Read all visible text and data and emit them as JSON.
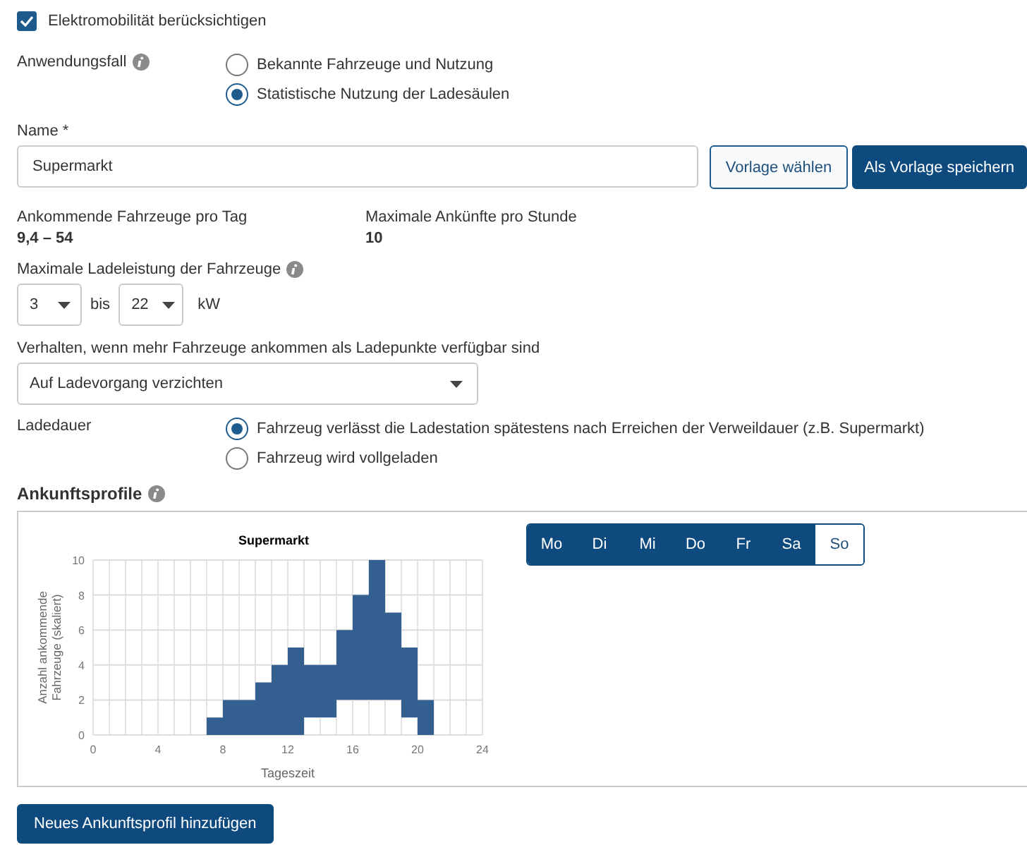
{
  "checkbox": {
    "label": "Elektromobilität berücksichtigen",
    "checked": true
  },
  "use_case": {
    "label": "Anwendungsfall",
    "options": [
      {
        "label": "Bekannte Fahrzeuge und Nutzung",
        "selected": false
      },
      {
        "label": "Statistische Nutzung der Ladesäulen",
        "selected": true
      }
    ]
  },
  "name_field": {
    "label": "Name *",
    "value": "Supermarkt"
  },
  "buttons": [
    {
      "label": "Vorlage wählen",
      "kind": "secondary"
    },
    {
      "label": "Als Vorlage speichern",
      "kind": "primary"
    }
  ],
  "stats": [
    {
      "label": "Ankommende Fahrzeuge pro Tag",
      "value": "9,4 – 54"
    },
    {
      "label": "Maximale Ankünfte pro Stunde",
      "value": "10"
    }
  ],
  "power": {
    "label": "Maximale Ladeleistung der Fahrzeuge",
    "from": "3",
    "separator": "bis",
    "to": "22",
    "unit": "kW"
  },
  "behavior": {
    "label": "Verhalten, wenn mehr Fahrzeuge ankommen als Ladepunkte verfügbar sind",
    "value": "Auf Ladevorgang verzichten"
  },
  "duration": {
    "label": "Ladedauer",
    "options": [
      {
        "label": "Fahrzeug verlässt die Ladestation spätestens nach Erreichen der Verweildauer (z.B. Supermarkt)",
        "selected": true
      },
      {
        "label": "Fahrzeug wird vollgeladen",
        "selected": false
      }
    ]
  },
  "profiles": {
    "title": "Ankunftsprofile",
    "chart_data": {
      "type": "area",
      "title": "Supermarkt",
      "xlabel": "Tageszeit",
      "ylabel": "Anzahl ankommende Fahrzeuge (skaliert)",
      "x": [
        7,
        8,
        8,
        9,
        9,
        10,
        10,
        11,
        11,
        12,
        12,
        13,
        13,
        14,
        14,
        15,
        15,
        16,
        16,
        17,
        17,
        18,
        18,
        19,
        19,
        20,
        20,
        21
      ],
      "series": [
        {
          "color": "#335f91",
          "values": [
            1,
            1,
            2,
            2,
            2,
            2,
            3,
            3,
            4,
            4,
            5,
            5,
            4,
            4,
            4,
            4,
            6,
            6,
            8,
            8,
            10,
            10,
            7,
            7,
            5,
            5,
            2,
            2
          ]
        },
        {
          "color": "#ffffff",
          "values": [
            0,
            0,
            0,
            0,
            0,
            0,
            0,
            0,
            0,
            0,
            0,
            0,
            1,
            1,
            1,
            1,
            2,
            2,
            2,
            2,
            2,
            2,
            2,
            2,
            1,
            1,
            0,
            0
          ]
        }
      ],
      "grid": true,
      "xlim": [
        0,
        24
      ],
      "ylim": [
        0,
        10
      ],
      "xticks": [
        0,
        4,
        8,
        12,
        16,
        20,
        24
      ],
      "yticks": [
        0,
        2,
        4,
        6,
        8,
        10
      ]
    },
    "days": [
      {
        "label": "Mo",
        "selected": false
      },
      {
        "label": "Di",
        "selected": false
      },
      {
        "label": "Mi",
        "selected": false
      },
      {
        "label": "Do",
        "selected": false
      },
      {
        "label": "Fr",
        "selected": false
      },
      {
        "label": "Sa",
        "selected": false
      },
      {
        "label": "So",
        "selected": true
      }
    ]
  },
  "add_button": "Neues Ankunftsprofil hinzufügen"
}
